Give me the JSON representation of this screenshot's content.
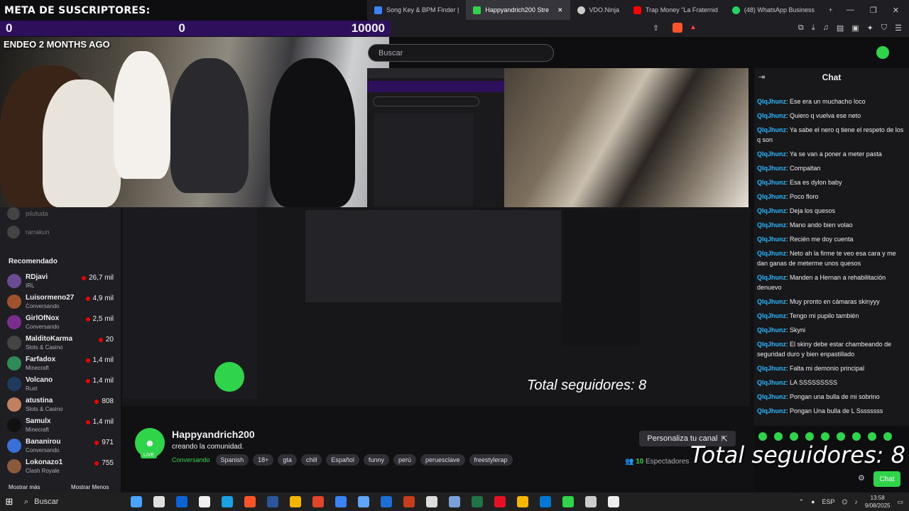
{
  "browser": {
    "tabs": [
      {
        "label": "Song Key & BPM Finder |",
        "color": "#3b82f6"
      },
      {
        "label": "Happyandrich200 Stre",
        "color": "#2fd44a",
        "active": true
      },
      {
        "label": "VDO.Ninja",
        "color": "#cccccc"
      },
      {
        "label": "Trap Money \"La Fraternid",
        "color": "#ff0000"
      },
      {
        "label": "(48) WhatsApp Business",
        "color": "#25d366"
      }
    ],
    "new_tab": "+",
    "win_min": "—",
    "win_max": "❐",
    "win_close": "✕"
  },
  "overlay": {
    "goal_title": "META DE SUSCRIPTORES:",
    "goal_left": "0",
    "goal_mid": "0",
    "goal_right": "10000",
    "ended": "ENDEO 2 MONTHS AGO"
  },
  "search": {
    "placeholder": "Buscar"
  },
  "chat": {
    "title": "Chat",
    "messages": [
      {
        "user": "QlqJhunz",
        "text": "Ese era un muchacho loco"
      },
      {
        "user": "QlqJhunz",
        "text": "Quiero q vuelva ese neto"
      },
      {
        "user": "QlqJhunz",
        "text": "Ya sabe el nero q tiene el respeto de los q son"
      },
      {
        "user": "QlqJhunz",
        "text": "Ya se van a poner a meter pasta"
      },
      {
        "user": "QlqJhunz",
        "text": "Compaltan"
      },
      {
        "user": "QlqJhunz",
        "text": "Esa es dylon baby"
      },
      {
        "user": "QlqJhunz",
        "text": "Poco floro"
      },
      {
        "user": "QlqJhunz",
        "text": "Deja los quesos"
      },
      {
        "user": "QlqJhunz",
        "text": "Mano ando bien volao"
      },
      {
        "user": "QlqJhunz",
        "text": "Recién me doy cuenta"
      },
      {
        "user": "QlqJhunz",
        "text": "Neto ah la firme te veo esa cara y me dan ganas de meterme unos quesos"
      },
      {
        "user": "QlqJhunz",
        "text": "Manden a Hernan a rehabilitación denuevo"
      },
      {
        "user": "QlqJhunz",
        "text": "Muy pronto en cámaras skinyyy"
      },
      {
        "user": "QlqJhunz",
        "text": "Tengo mi pupilo también"
      },
      {
        "user": "QlqJhunz",
        "text": "Skyni"
      },
      {
        "user": "QlqJhunz",
        "text": "El skiny debe estar chambeando de seguridad duro y bien enpastillado"
      },
      {
        "user": "QlqJhunz",
        "text": "Falta mi demonio principal"
      },
      {
        "user": "QlqJhunz",
        "text": "LA SSSSSSSSS"
      },
      {
        "user": "QlqJhunz",
        "text": "Pongan una bulla de mi sobrino"
      },
      {
        "user": "QlqJhunz",
        "text": "Pongan Una bulla de L Ssssssss"
      }
    ],
    "chat_button": "Chat"
  },
  "sidebar": {
    "faded": [
      "pilutuda",
      "rarrakun"
    ],
    "recommended_title": "Recomendado",
    "channels": [
      {
        "name": "RDjavi",
        "category": "IRL",
        "viewers": "26,7 mil",
        "color": "#6a4c93"
      },
      {
        "name": "Luisormeno27",
        "category": "Conversando",
        "viewers": "4,9 mil",
        "color": "#a0522d"
      },
      {
        "name": "GirlOfNox",
        "category": "Conversando",
        "viewers": "2,5 mil",
        "color": "#7b2d8e"
      },
      {
        "name": "MalditoKarma",
        "category": "Slots & Casino",
        "viewers": "20",
        "color": "#444444"
      },
      {
        "name": "Farfadox",
        "category": "Minecraft",
        "viewers": "1,4 mil",
        "color": "#2e8b57"
      },
      {
        "name": "Volcano",
        "category": "Rust",
        "viewers": "1,4 mil",
        "color": "#1e3a5f"
      },
      {
        "name": "atustina",
        "category": "Slots & Casino",
        "viewers": "808",
        "color": "#c08060"
      },
      {
        "name": "Samulx",
        "category": "Minecraft",
        "viewers": "1,4 mil",
        "color": "#111111"
      },
      {
        "name": "Bananirou",
        "category": "Conversando",
        "viewers": "971",
        "color": "#3a6fd8"
      },
      {
        "name": "Lokonazo1",
        "category": "Clash Royale",
        "viewers": "755",
        "color": "#8b5a3c"
      }
    ],
    "show_more": "Mostrar más",
    "show_less": "Mostrar Menos"
  },
  "channel": {
    "name": "Happyandrich200",
    "subtitle": "creando la comunidad.",
    "live": "LIVE",
    "category": "Conversando",
    "tags": [
      "Spanish",
      "18+",
      "gta",
      "chill",
      "Español",
      "funny",
      "perú",
      "peruesclave",
      "freestylerap"
    ],
    "viewers_count": "10",
    "viewers_label": "Espectadores",
    "customize": "Personaliza tu canal",
    "followers_overlay": "Total seguidores: 8"
  },
  "taskbar": {
    "start": "⊞",
    "search": "Buscar",
    "lang": "ESP",
    "time": "13:58",
    "date": "9/08/2025",
    "apps": [
      "#4aa3ff",
      "#e0e0e0",
      "#0a64d8",
      "#f0f0f0",
      "#1ba1e2",
      "#fb542b",
      "#2b579a",
      "#f4b400",
      "#e0452b",
      "#3b82f6",
      "#60a5fa",
      "#1d6fd3",
      "#c43e1c",
      "#dddddd",
      "#7aa0d8",
      "#217346",
      "#e81123",
      "#f7b500",
      "#0078d4",
      "#2fd44a",
      "#cccccc",
      "#eeeeee"
    ]
  }
}
